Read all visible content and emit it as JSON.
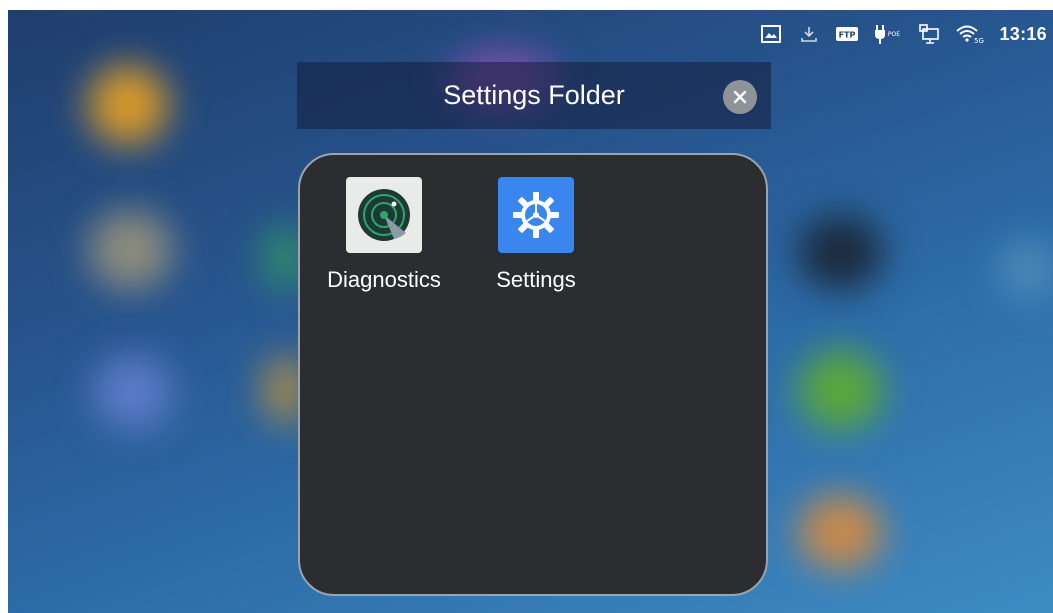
{
  "status_bar": {
    "time": "13:16",
    "icons": [
      "screenshot-icon",
      "download-icon",
      "ftp-icon",
      "poe-power-icon",
      "ethernet-icon",
      "wifi-icon"
    ],
    "ftp_label": "FTP",
    "poe_label": "POE",
    "wifi_label": "5G"
  },
  "folder": {
    "title": "Settings Folder",
    "close_icon": "close-icon",
    "apps": [
      {
        "label": "Diagnostics",
        "icon": "diagnostics-radar-icon"
      },
      {
        "label": "Settings",
        "icon": "settings-gear-icon"
      }
    ]
  },
  "colors": {
    "folder_background": "#2b2d30",
    "settings_icon_blue": "#3a86ee",
    "diagnostics_green": "#2aa86a"
  }
}
